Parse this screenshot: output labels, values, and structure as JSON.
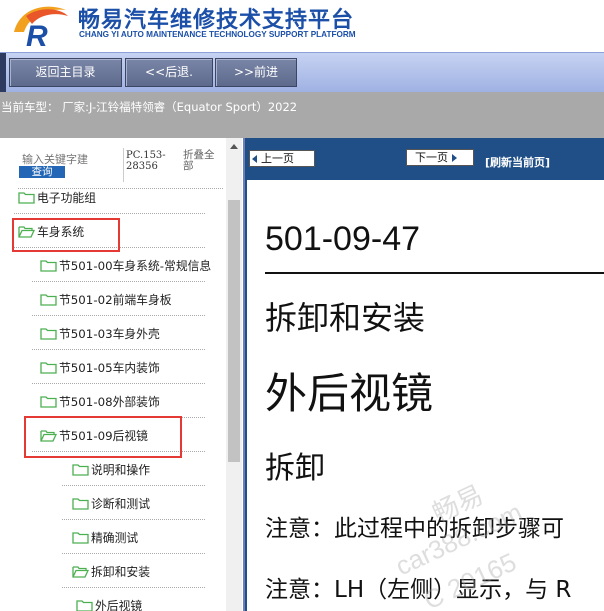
{
  "header": {
    "title_cn": "畅易汽车维修技术支持平台",
    "title_en": "CHANG YI AUTO MAINTENANCE TECHNOLOGY SUPPORT PLATFORM"
  },
  "nav": {
    "home": "返回主目录",
    "back": "<<后退.",
    "forward": ">>前进"
  },
  "current_model": "当前车型： 厂家:J-江铃福特领睿（Equator Sport）2022",
  "sidebar": {
    "search_placeholder": "输入关键字建",
    "search_button": "查询",
    "pc_code": "PC.153-28356",
    "collapse_all": "折叠全部",
    "tree": [
      {
        "label": "电子功能组",
        "level": 0,
        "open": false
      },
      {
        "label": "车身系统",
        "level": 0,
        "open": true,
        "highlighted": true
      },
      {
        "label": "节501-00车身系统-常规信息",
        "level": 1,
        "open": false
      },
      {
        "label": "节501-02前端车身板",
        "level": 1,
        "open": false
      },
      {
        "label": "节501-03车身外壳",
        "level": 1,
        "open": false
      },
      {
        "label": "节501-05车内装饰",
        "level": 1,
        "open": false
      },
      {
        "label": "节501-08外部装饰",
        "level": 1,
        "open": false
      },
      {
        "label": "节501-09后视镜",
        "level": 1,
        "open": true,
        "highlighted": true
      },
      {
        "label": "说明和操作",
        "level": 2,
        "open": false
      },
      {
        "label": "诊断和测试",
        "level": 2,
        "open": false
      },
      {
        "label": "精确测试",
        "level": 2,
        "open": false
      },
      {
        "label": "拆卸和安装",
        "level": 2,
        "open": true
      },
      {
        "label": "外后视镜",
        "level": 3,
        "open": false
      }
    ]
  },
  "content": {
    "prev_page": "上一页",
    "next_page": "下一页",
    "refresh": "[刷新当前页]",
    "doc_number": "501-09-47",
    "heading1": "拆卸和安装",
    "heading2": "外后视镜",
    "heading3": "拆卸",
    "note1": "注意：此过程中的拆卸步骤可",
    "note2": "注意：LH（左侧）显示，与 R"
  },
  "watermark": {
    "line1": "畅易",
    "line2": "car388.com",
    "line3": "C 20165"
  },
  "colors": {
    "brand_blue": "#1b4fa8",
    "nav_bar": "#b4c3ec",
    "model_bar": "#a9a9a9",
    "content_header": "#1f4f86",
    "highlight": "#e53935",
    "folder": "#4caf50"
  }
}
